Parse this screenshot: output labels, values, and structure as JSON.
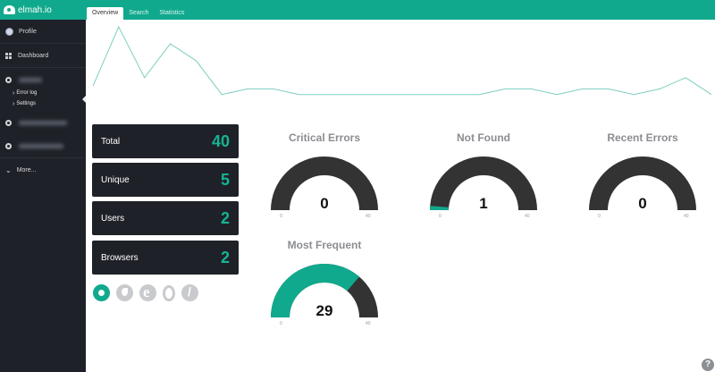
{
  "app": {
    "name": "elmah.io"
  },
  "sidebar": {
    "profile": "Profile",
    "dashboard": "Dashboard",
    "log_sub_items": [
      "Error log",
      "Settings"
    ],
    "more": "More..."
  },
  "tabs": [
    "Overview",
    "Search",
    "Statistics"
  ],
  "sparkline": {
    "values": [
      5,
      26,
      8,
      20,
      14,
      2,
      4,
      4,
      2,
      2,
      2,
      2,
      2,
      2,
      2,
      2,
      4,
      4,
      2,
      4,
      4,
      2,
      4,
      8,
      2
    ],
    "color": "#7ccfc0"
  },
  "stats": [
    {
      "label": "Total",
      "value": "40"
    },
    {
      "label": "Unique",
      "value": "5"
    },
    {
      "label": "Users",
      "value": "2"
    },
    {
      "label": "Browsers",
      "value": "2"
    }
  ],
  "browsers": [
    "chrome-icon",
    "firefox-icon",
    "ie-icon",
    "opera-icon",
    "other-browser-icon"
  ],
  "gauges": [
    {
      "title": "Critical Errors",
      "value": 0,
      "min": "0",
      "max": "40",
      "display": "0"
    },
    {
      "title": "Not Found",
      "value": 1,
      "min": "0",
      "max": "40",
      "display": "1"
    },
    {
      "title": "Recent Errors",
      "value": 0,
      "min": "0",
      "max": "40",
      "display": "0"
    },
    {
      "title": "Most Frequent",
      "value": 29,
      "min": "0",
      "max": "40",
      "display": "29"
    }
  ],
  "colors": {
    "accent": "#11a98d",
    "dark": "#1f2128",
    "gauge_bg": "#333333"
  },
  "help": "?"
}
